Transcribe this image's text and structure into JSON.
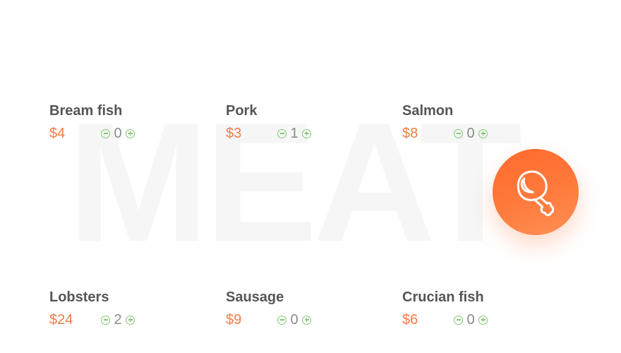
{
  "watermark": "MEAT",
  "currency": "$",
  "products": [
    {
      "name": "Bream fish",
      "price": "$4",
      "qty": "0"
    },
    {
      "name": "Pork",
      "price": "$3",
      "qty": "1"
    },
    {
      "name": "Salmon",
      "price": "$8",
      "qty": "0"
    },
    {
      "name": "Lobsters",
      "price": "$24",
      "qty": "2"
    },
    {
      "name": "Sausage",
      "price": "$9",
      "qty": "0"
    },
    {
      "name": "Crucian fish",
      "price": "$6",
      "qty": "0"
    }
  ],
  "fab": {
    "icon": "meat-drumstick-icon"
  },
  "colors": {
    "price": "#f47c46",
    "name": "#555555",
    "stepper": "#7ec86f",
    "accent": "#ff6a2b"
  }
}
